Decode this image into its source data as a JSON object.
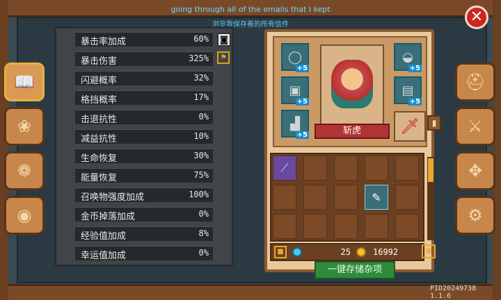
{
  "caption": {
    "line1": "going through all of the emails that I kept",
    "line2": "浏览我保存着的所有信件"
  },
  "close_icon": "close-icon",
  "stats": [
    {
      "label": "暴击率加成",
      "value": "60%"
    },
    {
      "label": "暴击伤害",
      "value": "325%"
    },
    {
      "label": "闪避概率",
      "value": "32%"
    },
    {
      "label": "格挡概率",
      "value": "17%"
    },
    {
      "label": "击退抗性",
      "value": "0%"
    },
    {
      "label": "减益抗性",
      "value": "10%"
    },
    {
      "label": "生命恢复",
      "value": "30%"
    },
    {
      "label": "能量恢复",
      "value": "75%"
    },
    {
      "label": "召唤物强度加成",
      "value": "100%"
    },
    {
      "label": "金币掉落加成",
      "value": "0%"
    },
    {
      "label": "经验值加成",
      "value": "8%"
    },
    {
      "label": "幸运值加成",
      "value": "0%"
    }
  ],
  "equipment": {
    "slots": [
      {
        "icon": "ring-icon",
        "plus": "+5"
      },
      {
        "icon": "helmet-icon",
        "plus": "+5"
      },
      {
        "icon": "armor-icon",
        "plus": "+5"
      },
      {
        "icon": "chestplate-icon",
        "plus": "+5"
      },
      {
        "icon": "boots-icon",
        "plus": "+5"
      },
      {
        "icon": "locked-weapon-icon",
        "plus": ""
      }
    ],
    "character_name": "斩虎"
  },
  "currency": {
    "gems": "25",
    "coins": "16992"
  },
  "store_button": "一键存储杂项",
  "build_id": "PID20249738 1.1.6"
}
